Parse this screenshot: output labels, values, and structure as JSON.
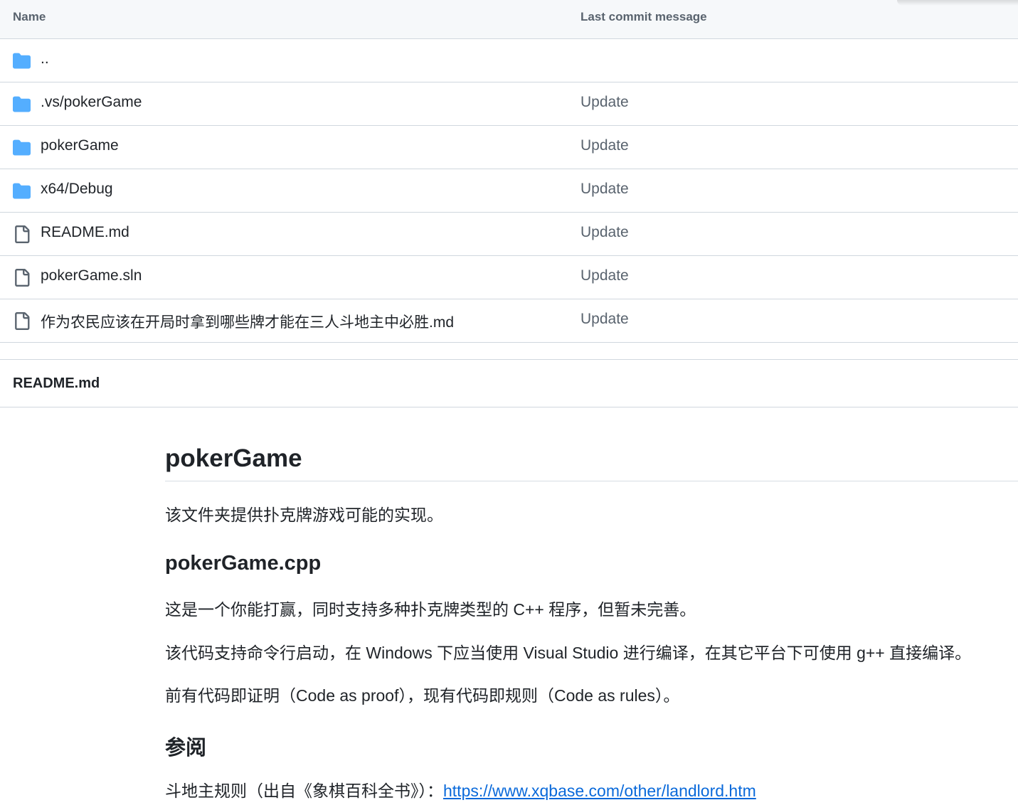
{
  "table": {
    "headers": {
      "name": "Name",
      "message": "Last commit message"
    },
    "rows": [
      {
        "type": "folder",
        "icon": "folder-icon",
        "name": "..",
        "message": ""
      },
      {
        "type": "folder",
        "icon": "folder-icon",
        "name": ".vs/pokerGame",
        "message": "Update"
      },
      {
        "type": "folder",
        "icon": "folder-icon",
        "name": "pokerGame",
        "message": "Update"
      },
      {
        "type": "folder",
        "icon": "folder-icon",
        "name": "x64/Debug",
        "message": "Update"
      },
      {
        "type": "file",
        "icon": "file-icon",
        "name": "README.md",
        "message": "Update"
      },
      {
        "type": "file",
        "icon": "file-icon",
        "name": "pokerGame.sln",
        "message": "Update"
      },
      {
        "type": "file",
        "icon": "file-icon",
        "name": "作为农民应该在开局时拿到哪些牌才能在三人斗地主中必胜.md",
        "message": "Update"
      }
    ]
  },
  "readme": {
    "filename": "README.md",
    "h1": "pokerGame",
    "intro": "该文件夹提供扑克牌游戏可能的实现。",
    "h2_cpp": "pokerGame.cpp",
    "p1": "这是一个你能打赢，同时支持多种扑克牌类型的 C++ 程序，但暂未完善。",
    "p2": "该代码支持命令行启动，在 Windows 下应当使用 Visual Studio 进行编译，在其它平台下可使用 g++ 直接编译。",
    "p3": "前有代码即证明（Code as proof），现有代码即规则（Code as rules）。",
    "h2_see": "参阅",
    "ref_prefix": "斗地主规则（出自《象棋百科全书》）：",
    "ref_link": "https://www.xqbase.com/other/landlord.htm"
  },
  "colors": {
    "folder": "#54aeff",
    "file_icon": "#59636e",
    "link": "#0969da",
    "muted": "#59636e"
  }
}
